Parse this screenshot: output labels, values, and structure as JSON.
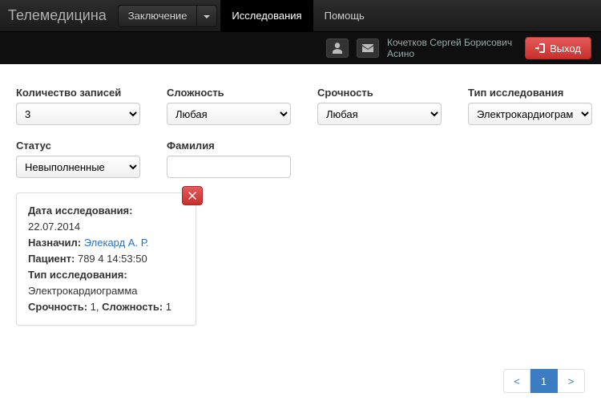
{
  "header": {
    "brand": "Телемедицина",
    "conclusion_btn": "Заключение",
    "tab_studies": "Исследования",
    "tab_help": "Помощь"
  },
  "userbar": {
    "name": "Кочетков Сергей Борисович",
    "location": "Асино",
    "logout": "Выход"
  },
  "filters": {
    "records_label": "Количество записей",
    "records_value": "3",
    "complexity_label": "Сложность",
    "complexity_value": "Любая",
    "urgency_label": "Срочность",
    "urgency_value": "Любая",
    "type_label": "Тип исследования",
    "type_value": "Электрокардиограмма",
    "status_label": "Статус",
    "status_value": "Невыполненные",
    "surname_label": "Фамилия",
    "surname_value": ""
  },
  "card": {
    "date_label": "Дата исследования:",
    "date_value": "22.07.2014",
    "assigned_label": "Назначил:",
    "assigned_value": "Элекард А. Р.",
    "patient_label": "Пациент:",
    "patient_value": "789 4 14:53:50",
    "type_label": "Тип исследования:",
    "type_value": "Электрокардиограмма",
    "urgency_label": "Срочность:",
    "urgency_value": "1",
    "complexity_label": "Сложность:",
    "complexity_value": "1"
  },
  "pager": {
    "prev": "<",
    "page": "1",
    "next": ">"
  }
}
